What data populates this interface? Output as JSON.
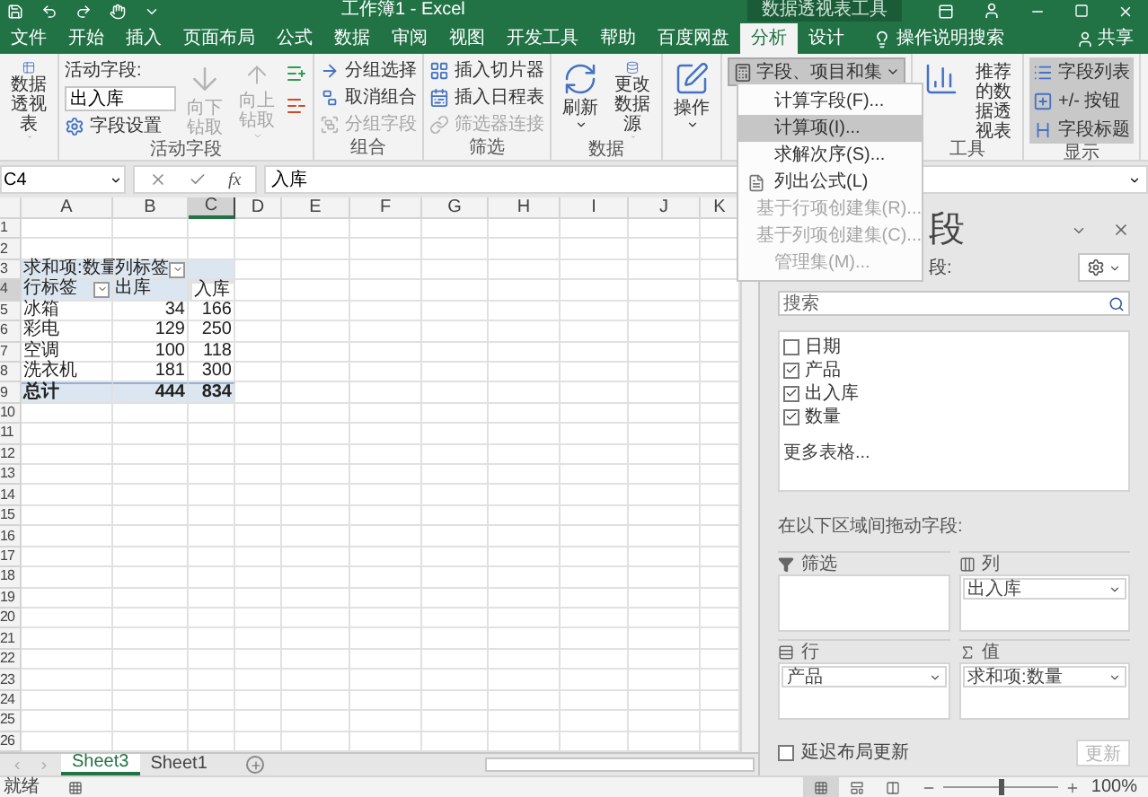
{
  "title_bar": {
    "title": "工作簿1 - Excel",
    "context_label": "数据透视表工具"
  },
  "tabs": [
    {
      "label": "文件",
      "selected": false
    },
    {
      "label": "开始",
      "selected": false
    },
    {
      "label": "插入",
      "selected": false
    },
    {
      "label": "页面布局",
      "selected": false
    },
    {
      "label": "公式",
      "selected": false
    },
    {
      "label": "数据",
      "selected": false
    },
    {
      "label": "审阅",
      "selected": false
    },
    {
      "label": "视图",
      "selected": false
    },
    {
      "label": "开发工具",
      "selected": false
    },
    {
      "label": "帮助",
      "selected": false
    },
    {
      "label": "百度网盘",
      "selected": false
    },
    {
      "label": "分析",
      "selected": true
    },
    {
      "label": "设计",
      "selected": false
    }
  ],
  "tell_me": "操作说明搜索",
  "share": "共享",
  "ribbon": {
    "groups": [
      {
        "columns": [
          [
            {
              "kind": "large",
              "label": "数据透视表",
              "dropdown": true
            }
          ]
        ]
      },
      {
        "label": "活动字段",
        "columns": [
          [
            {
              "kind": "caption",
              "label": "活动字段:"
            },
            {
              "kind": "input",
              "value": "出入库"
            },
            {
              "kind": "small",
              "label": "字段设置"
            }
          ],
          [
            {
              "kind": "large",
              "label": "向下钻取",
              "disabled": true
            }
          ],
          [
            {
              "kind": "large",
              "label": "向上钻取",
              "disabled": true,
              "dropdown": true
            }
          ],
          [
            {
              "kind": "icon"
            },
            {
              "kind": "icon"
            }
          ]
        ]
      },
      {
        "label": "组合",
        "columns": [
          [
            {
              "kind": "small",
              "label": "分组选择"
            },
            {
              "kind": "small",
              "label": "取消组合"
            },
            {
              "kind": "small",
              "label": "分组字段",
              "disabled": true
            }
          ]
        ]
      },
      {
        "label": "筛选",
        "columns": [
          [
            {
              "kind": "small",
              "label": "插入切片器"
            },
            {
              "kind": "small",
              "label": "插入日程表"
            },
            {
              "kind": "small",
              "label": "筛选器连接",
              "disabled": true
            }
          ]
        ]
      },
      {
        "label": "数据",
        "columns": [
          [
            {
              "kind": "large",
              "label": "刷新",
              "dropdown": true
            }
          ],
          [
            {
              "kind": "large",
              "label": "更改数据源",
              "dropdown": true
            }
          ]
        ]
      },
      {
        "columns": [
          [
            {
              "kind": "large",
              "label": "操作",
              "dropdown": true
            }
          ]
        ]
      },
      {
        "columns": [
          [
            {
              "kind": "menu",
              "label": "字段、项目和集",
              "dropdown": true,
              "open": true
            }
          ]
        ]
      },
      {
        "label": "工具",
        "columns": [
          [
            {
              "kind": "large"
            }
          ],
          [
            {
              "kind": "large",
              "label": "推荐的数据透视表"
            }
          ]
        ]
      },
      {
        "label": "显示",
        "columns": [
          [
            {
              "kind": "toggle",
              "label": "字段列表",
              "selected": true
            },
            {
              "kind": "toggle",
              "label": "+/- 按钮",
              "selected": true
            },
            {
              "kind": "toggle",
              "label": "字段标题",
              "selected": true
            }
          ]
        ]
      }
    ]
  },
  "menu": {
    "items": [
      {
        "kind": "plain",
        "label": "计算字段(F)...",
        "selected": false,
        "disabled": false
      },
      {
        "kind": "plain",
        "label": "计算项(I)...",
        "selected": true,
        "disabled": false
      },
      {
        "kind": "plain",
        "label": "求解次序(S)...",
        "selected": false,
        "disabled": false
      },
      {
        "kind": "icon",
        "label": "列出公式(L)",
        "selected": false,
        "disabled": false
      },
      {
        "kind": "plain",
        "label": "基于行项创建集(R)...",
        "selected": false,
        "disabled": true
      },
      {
        "kind": "plain",
        "label": "基于列项创建集(C)...",
        "selected": false,
        "disabled": true
      },
      {
        "kind": "plain",
        "label": "管理集(M)...",
        "selected": false,
        "disabled": true
      }
    ]
  },
  "formula_bar": {
    "name_box": "C4",
    "fx_label": "fx",
    "formula": "入库"
  },
  "sheet": {
    "columns": [
      "A",
      "B",
      "C",
      "D",
      "E",
      "F",
      "G",
      "H",
      "I",
      "J",
      "K"
    ],
    "row_numbers": [
      "1",
      "2",
      "3",
      "4",
      "5",
      "6",
      "7",
      "8",
      "9",
      "10",
      "11",
      "12",
      "13",
      "14",
      "15",
      "16",
      "17",
      "18",
      "19",
      "20",
      "21",
      "22",
      "23",
      "24",
      "25",
      "26"
    ],
    "pivot": {
      "corner": "求和项:数量",
      "col_label": "列标签",
      "row_label": "行标签",
      "columns": [
        {
          "label": "出库",
          "selected": false
        },
        {
          "label": "入库",
          "selected": true
        }
      ],
      "rows": [
        {
          "label": "冰箱",
          "values": [
            "34",
            "166"
          ]
        },
        {
          "label": "彩电",
          "values": [
            "129",
            "250"
          ]
        },
        {
          "label": "空调",
          "values": [
            "100",
            "118"
          ]
        },
        {
          "label": "洗衣机",
          "values": [
            "181",
            "300"
          ]
        }
      ],
      "total": {
        "label": "总计",
        "values": [
          "444",
          "834"
        ]
      }
    }
  },
  "sheet_tabs": [
    {
      "label": "Sheet3",
      "selected": true
    },
    {
      "label": "Sheet1",
      "selected": false
    }
  ],
  "field_pane": {
    "title": "段",
    "subtitle": "段:",
    "search": {
      "placeholder": "搜索"
    },
    "fields": [
      {
        "label": "日期",
        "checked": false
      },
      {
        "label": "产品",
        "checked": true
      },
      {
        "label": "出入库",
        "checked": true
      },
      {
        "label": "数量",
        "checked": true
      }
    ],
    "more": "更多表格...",
    "areas_hint": "在以下区域间拖动字段:",
    "areas": [
      {
        "kind": "filter",
        "label": "筛选"
      },
      {
        "kind": "columns",
        "label": "列",
        "fields": [
          "出入库"
        ]
      },
      {
        "kind": "rows",
        "label": "行",
        "fields": [
          "产品"
        ]
      },
      {
        "kind": "values",
        "label": "值",
        "fields": [
          "求和项:数量"
        ]
      }
    ],
    "defer": {
      "label": "延迟布局更新",
      "checked": false
    },
    "update_button": {
      "label": "更新",
      "disabled": true
    }
  },
  "status_bar": {
    "text": "就绪",
    "views": [
      {
        "selected": true
      },
      {
        "selected": false
      },
      {
        "selected": false
      }
    ],
    "zoom_slider": {
      "level": 0.5
    },
    "zoom": "100%"
  }
}
